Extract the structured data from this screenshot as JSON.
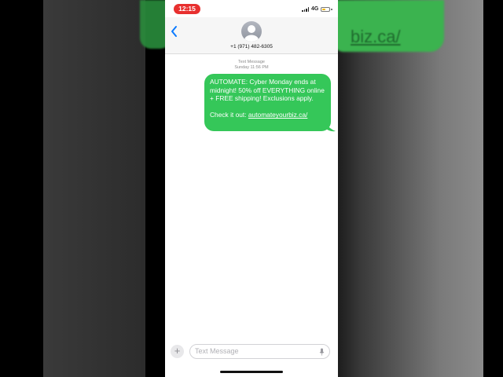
{
  "status_bar": {
    "time": "12:15",
    "network": "4G"
  },
  "header": {
    "contact_number": "+1 (971) 482-6305",
    "avatar_icon": "person-silhouette-icon",
    "back_icon": "chevron-left-icon"
  },
  "conversation": {
    "service_label": "Text Message",
    "timestamp": "Sunday 11:56 PM",
    "message": {
      "line1": "AUTOMATE: Cyber Monday ends at midnight! 50% off EVERYTHING online + FREE shipping! Exclusions apply.",
      "line2_prefix": "Check it out: ",
      "link": "automateyourbiz.ca/"
    }
  },
  "background": {
    "link_fragment": "biz.ca/"
  },
  "compose": {
    "placeholder": "Text Message",
    "add_icon": "plus-icon",
    "mic_icon": "microphone-icon"
  },
  "colors": {
    "bubble": "#35c759",
    "accent": "#0a7aff",
    "time_pill": "#e8302f"
  }
}
